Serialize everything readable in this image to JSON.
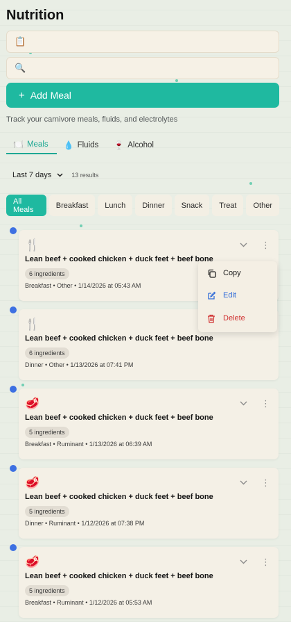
{
  "header": {
    "title": "Nutrition"
  },
  "top_field": {
    "icon": "clipboard-icon",
    "glyph": "📋"
  },
  "search": {
    "icon": "search-icon",
    "glyph": "🔍",
    "placeholder": ""
  },
  "add_button": {
    "plus": "+",
    "label": "Add Meal"
  },
  "subtitle": "Track your carnivore meals, fluids, and electrolytes",
  "tabs": [
    {
      "label": "Meals",
      "icon": "plate-icon",
      "glyph": "🍽️",
      "active": true
    },
    {
      "label": "Fluids",
      "icon": "droplet-icon",
      "glyph": "💧",
      "active": false
    },
    {
      "label": "Alcohol",
      "icon": "wine-glass-icon",
      "glyph": "🍷",
      "active": false
    }
  ],
  "filter": {
    "range": "Last 7 days",
    "results": "13 results"
  },
  "chips": [
    "All Meals",
    "Breakfast",
    "Lunch",
    "Dinner",
    "Snack",
    "Treat",
    "Other"
  ],
  "meals": [
    {
      "icon": "fork-knife-icon",
      "glyph": "🍴",
      "title": "Lean beef + cooked chicken + duck feet + beef bone",
      "badge": "6 ingredients",
      "meta": "Breakfast • Other • 1/14/2026 at 05:43 AM"
    },
    {
      "icon": "fork-knife-icon",
      "glyph": "🍴",
      "title": "Lean beef + cooked chicken + duck feet + beef bone",
      "badge": "6 ingredients",
      "meta": "Dinner • Other • 1/13/2026 at 07:41 PM"
    },
    {
      "icon": "steak-icon",
      "glyph": "🥩",
      "title": "Lean beef + cooked chicken + duck feet + beef bone",
      "badge": "5 ingredients",
      "meta": "Breakfast • Ruminant • 1/13/2026 at 06:39 AM"
    },
    {
      "icon": "steak-icon",
      "glyph": "🥩",
      "title": "Lean beef + cooked chicken + duck feet + beef bone",
      "badge": "5 ingredients",
      "meta": "Dinner • Ruminant • 1/12/2026 at 07:38 PM"
    },
    {
      "icon": "steak-icon",
      "glyph": "🥩",
      "title": "Lean beef + cooked chicken + duck feet + beef bone",
      "badge": "5 ingredients",
      "meta": "Breakfast • Ruminant • 1/12/2026 at 05:53 AM"
    }
  ],
  "context_menu": {
    "copy": "Copy",
    "edit": "Edit",
    "delete": "Delete"
  },
  "colors": {
    "accent": "#1fb9a0",
    "timeline_dot": "#3d70e2",
    "danger": "#d03030",
    "edit": "#2f6bd8"
  }
}
